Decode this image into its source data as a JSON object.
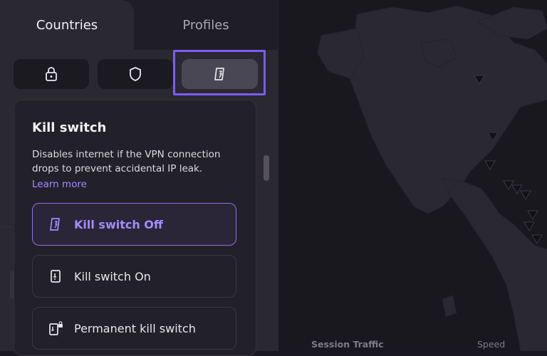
{
  "tabs": {
    "countries": "Countries",
    "profiles": "Profiles"
  },
  "feature_buttons": [
    {
      "icon": "lock-icon"
    },
    {
      "icon": "shield-icon"
    },
    {
      "icon": "kill-switch-icon",
      "active": true
    }
  ],
  "popover": {
    "title": "Kill switch",
    "description": "Disables internet if the VPN connection drops to prevent accidental IP leak.",
    "learn_more": "Learn more",
    "options": [
      {
        "label": "Kill switch Off",
        "icon": "kill-switch-off-icon",
        "selected": true
      },
      {
        "label": "Kill switch On",
        "icon": "kill-switch-on-icon",
        "selected": false
      },
      {
        "label": "Permanent kill switch",
        "icon": "permanent-kill-switch-icon",
        "selected": false
      }
    ]
  },
  "map": {
    "session_traffic": "Session Traffic",
    "speed": "Speed"
  },
  "colors": {
    "accent": "#7b5cf6",
    "accent_text": "#a48cff",
    "panel": "#2a2831",
    "background": "#1a1820"
  }
}
